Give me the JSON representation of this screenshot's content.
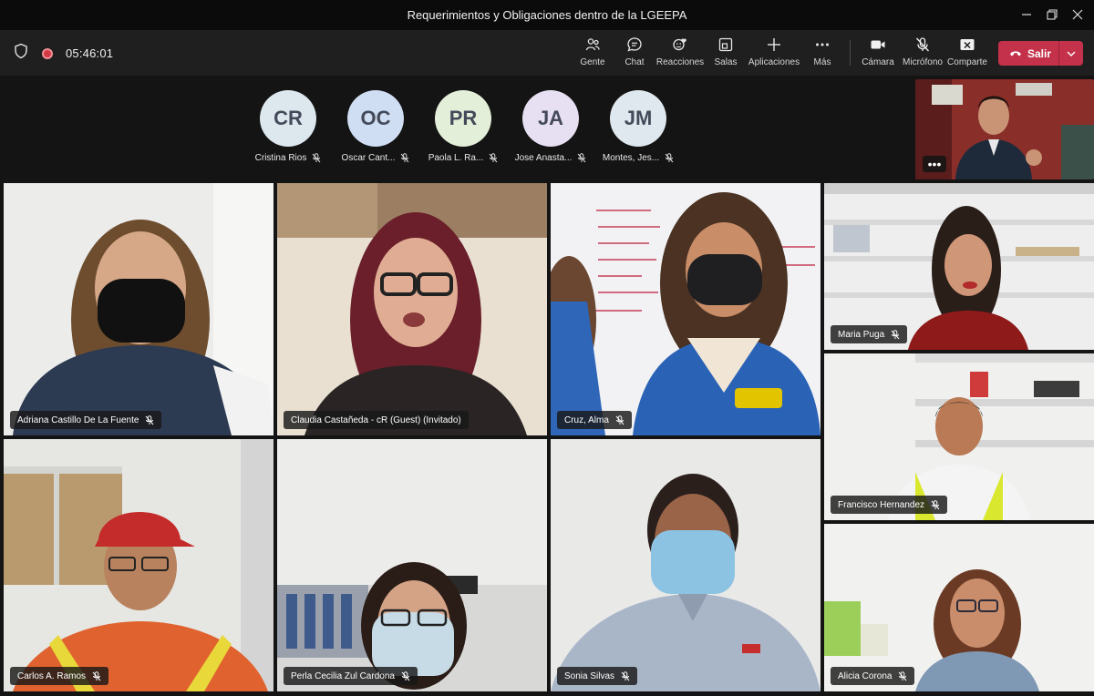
{
  "window": {
    "title": "Requerimientos y Obligaciones dentro de la LGEEPA"
  },
  "toolbar": {
    "timer": "05:46:01",
    "buttons": [
      {
        "label": "Gente",
        "icon": "people-icon"
      },
      {
        "label": "Chat",
        "icon": "chat-icon"
      },
      {
        "label": "Reacciones",
        "icon": "reactions-icon"
      },
      {
        "label": "Salas",
        "icon": "breakout-rooms-icon"
      },
      {
        "label": "Aplicaciones",
        "icon": "plus-icon"
      },
      {
        "label": "Más",
        "icon": "more-icon"
      },
      {
        "label": "Cámara",
        "icon": "camera-icon"
      },
      {
        "label": "Micrófono",
        "icon": "mic-off-icon"
      },
      {
        "label": "Comparte",
        "icon": "share-icon"
      }
    ],
    "leave_label": "Salir"
  },
  "avatars": [
    {
      "initials": "CR",
      "name": "Cristina Rios",
      "color": "#dde7ee"
    },
    {
      "initials": "OC",
      "name": "Oscar Cant...",
      "color": "#cfdef2"
    },
    {
      "initials": "PR",
      "name": "Paola L. Ra...",
      "color": "#e4efd9"
    },
    {
      "initials": "JA",
      "name": "Jose Anasta...",
      "color": "#e7e0f3"
    },
    {
      "initials": "JM",
      "name": "Montes, Jes...",
      "color": "#dfe8ee"
    }
  ],
  "participants": [
    {
      "name": "Adriana Castillo De La Fuente"
    },
    {
      "name": "Claudia Castañeda - cR (Guest) (Invitado)"
    },
    {
      "name": "Cruz, Alma"
    },
    {
      "name": "Maria Puga"
    },
    {
      "name": "Francisco Hernandez"
    },
    {
      "name": "Carlos A. Ramos"
    },
    {
      "name": "Perla Cecilia Zul Cardona"
    },
    {
      "name": "Sonia Silvas"
    },
    {
      "name": "Alicia Corona"
    }
  ],
  "self_view": {
    "more_label": "•••"
  },
  "colors": {
    "leave": "#c4314b",
    "active_speaker": "#7f85f5",
    "toolbar": "#1f1f1f"
  }
}
